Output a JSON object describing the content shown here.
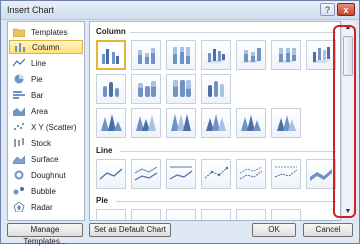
{
  "window": {
    "title": "Insert Chart",
    "help_label": "?",
    "close_label": "x"
  },
  "sidebar": {
    "items": [
      {
        "label": "Templates",
        "icon": "folder-icon"
      },
      {
        "label": "Column",
        "icon": "column-chart-icon",
        "selected": true
      },
      {
        "label": "Line",
        "icon": "line-chart-icon"
      },
      {
        "label": "Pie",
        "icon": "pie-chart-icon"
      },
      {
        "label": "Bar",
        "icon": "bar-chart-icon"
      },
      {
        "label": "Area",
        "icon": "area-chart-icon"
      },
      {
        "label": "X Y (Scatter)",
        "icon": "scatter-chart-icon"
      },
      {
        "label": "Stock",
        "icon": "stock-chart-icon"
      },
      {
        "label": "Surface",
        "icon": "surface-chart-icon"
      },
      {
        "label": "Doughnut",
        "icon": "doughnut-chart-icon"
      },
      {
        "label": "Bubble",
        "icon": "bubble-chart-icon"
      },
      {
        "label": "Radar",
        "icon": "radar-chart-icon"
      }
    ]
  },
  "sections": {
    "column": "Column",
    "line": "Line",
    "pie": "Pie"
  },
  "buttons": {
    "manage_templates": "Manage Templates...",
    "set_default": "Set as Default Chart",
    "ok": "OK",
    "cancel": "Cancel"
  },
  "colors": {
    "accent_blue": "#6f93c6",
    "highlight": "#d32020",
    "selected": "#ffdf7a"
  }
}
